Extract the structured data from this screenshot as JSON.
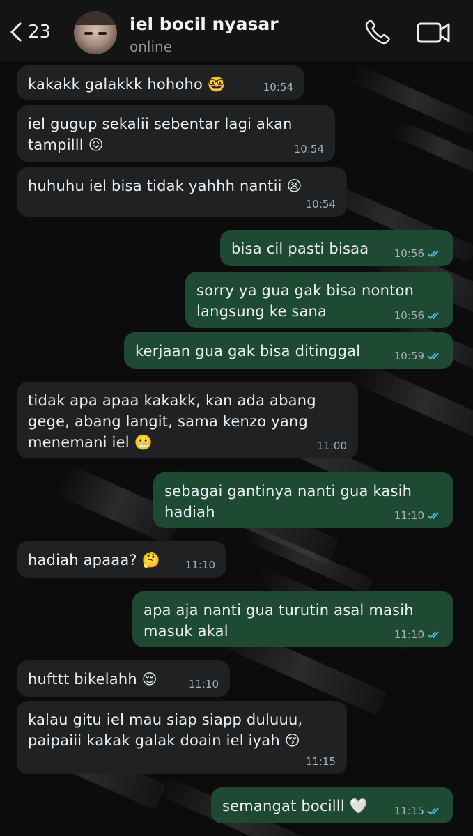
{
  "header": {
    "back_count": "23",
    "contact_name": "iel bocil nyasar",
    "status": "online",
    "icons": {
      "back": "chevron-left-icon",
      "call": "phone-icon",
      "video": "video-camera-icon"
    }
  },
  "colors": {
    "incoming_bubble": "#1f2123",
    "outgoing_bubble": "#1e4a34",
    "read_ticks": "#53bdeb",
    "background": "#0c0c0c"
  },
  "messages": [
    {
      "dir": "in",
      "text": "kakakk galakkk hohoho 🤓",
      "time": "10:54"
    },
    {
      "dir": "in",
      "text": "iel gugup sekalii sebentar lagi akan\ntampilll 😖",
      "time": "10:54"
    },
    {
      "dir": "in",
      "text": "huhuhu iel bisa tidak yahhh nantii 😫",
      "time": "10:54"
    },
    {
      "dir": "out",
      "text": "bisa cil pasti bisaa",
      "time": "10:56",
      "read": true
    },
    {
      "dir": "out",
      "text": "sorry ya gua gak bisa nonton\nlangsung ke sana",
      "time": "10:56",
      "read": true
    },
    {
      "dir": "out",
      "text": "kerjaan gua gak bisa ditinggal",
      "time": "10:59",
      "read": true
    },
    {
      "dir": "in",
      "text": "tidak apa apaa kakakk, kan ada abang\ngege, abang langit, sama kenzo yang\nmenemani iel 😬",
      "time": "11:00"
    },
    {
      "dir": "out",
      "text": "sebagai gantinya nanti gua kasih\nhadiah",
      "time": "11:10",
      "read": true
    },
    {
      "dir": "in",
      "text": "hadiah apaaa? 🤔",
      "time": "11:10"
    },
    {
      "dir": "out",
      "text": "apa aja nanti gua turutin asal masih\nmasuk akal",
      "time": "11:10",
      "read": true
    },
    {
      "dir": "in",
      "text": "hufttt bikelahh 😌",
      "time": "11:10"
    },
    {
      "dir": "in",
      "text": "kalau gitu iel mau siap siapp duluuu,\npaipaiii kakak galak doain iel iyah 😚",
      "time": "11:15"
    },
    {
      "dir": "out",
      "text": "semangat bocilll 🤍",
      "time": "11:15",
      "read": true
    }
  ]
}
